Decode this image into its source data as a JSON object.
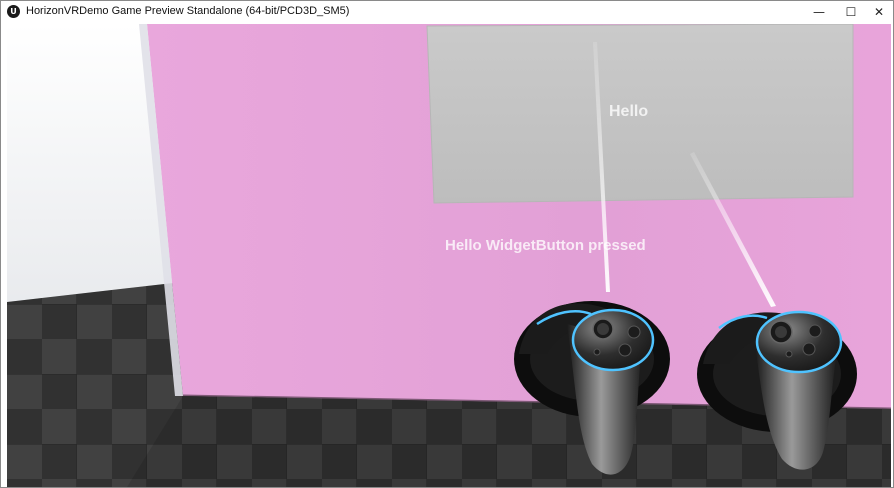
{
  "window": {
    "title": "HorizonVRDemo Game Preview Standalone (64-bit/PCD3D_SM5)",
    "app_icon": "unreal-engine-icon",
    "controls": {
      "minimize": "—",
      "maximize": "☐",
      "close": "✕"
    }
  },
  "scene": {
    "widget_panel_text": "Hello",
    "status_text": "Hello WidgetButton pressed",
    "colors": {
      "wall": "#e6a3d8",
      "panel": "#c4c4c4",
      "floor_dark": "#3c3c3c",
      "floor_light": "#555555",
      "controller_ring": "#4fc3ff"
    },
    "controllers": [
      "left-motion-controller",
      "right-motion-controller"
    ]
  }
}
